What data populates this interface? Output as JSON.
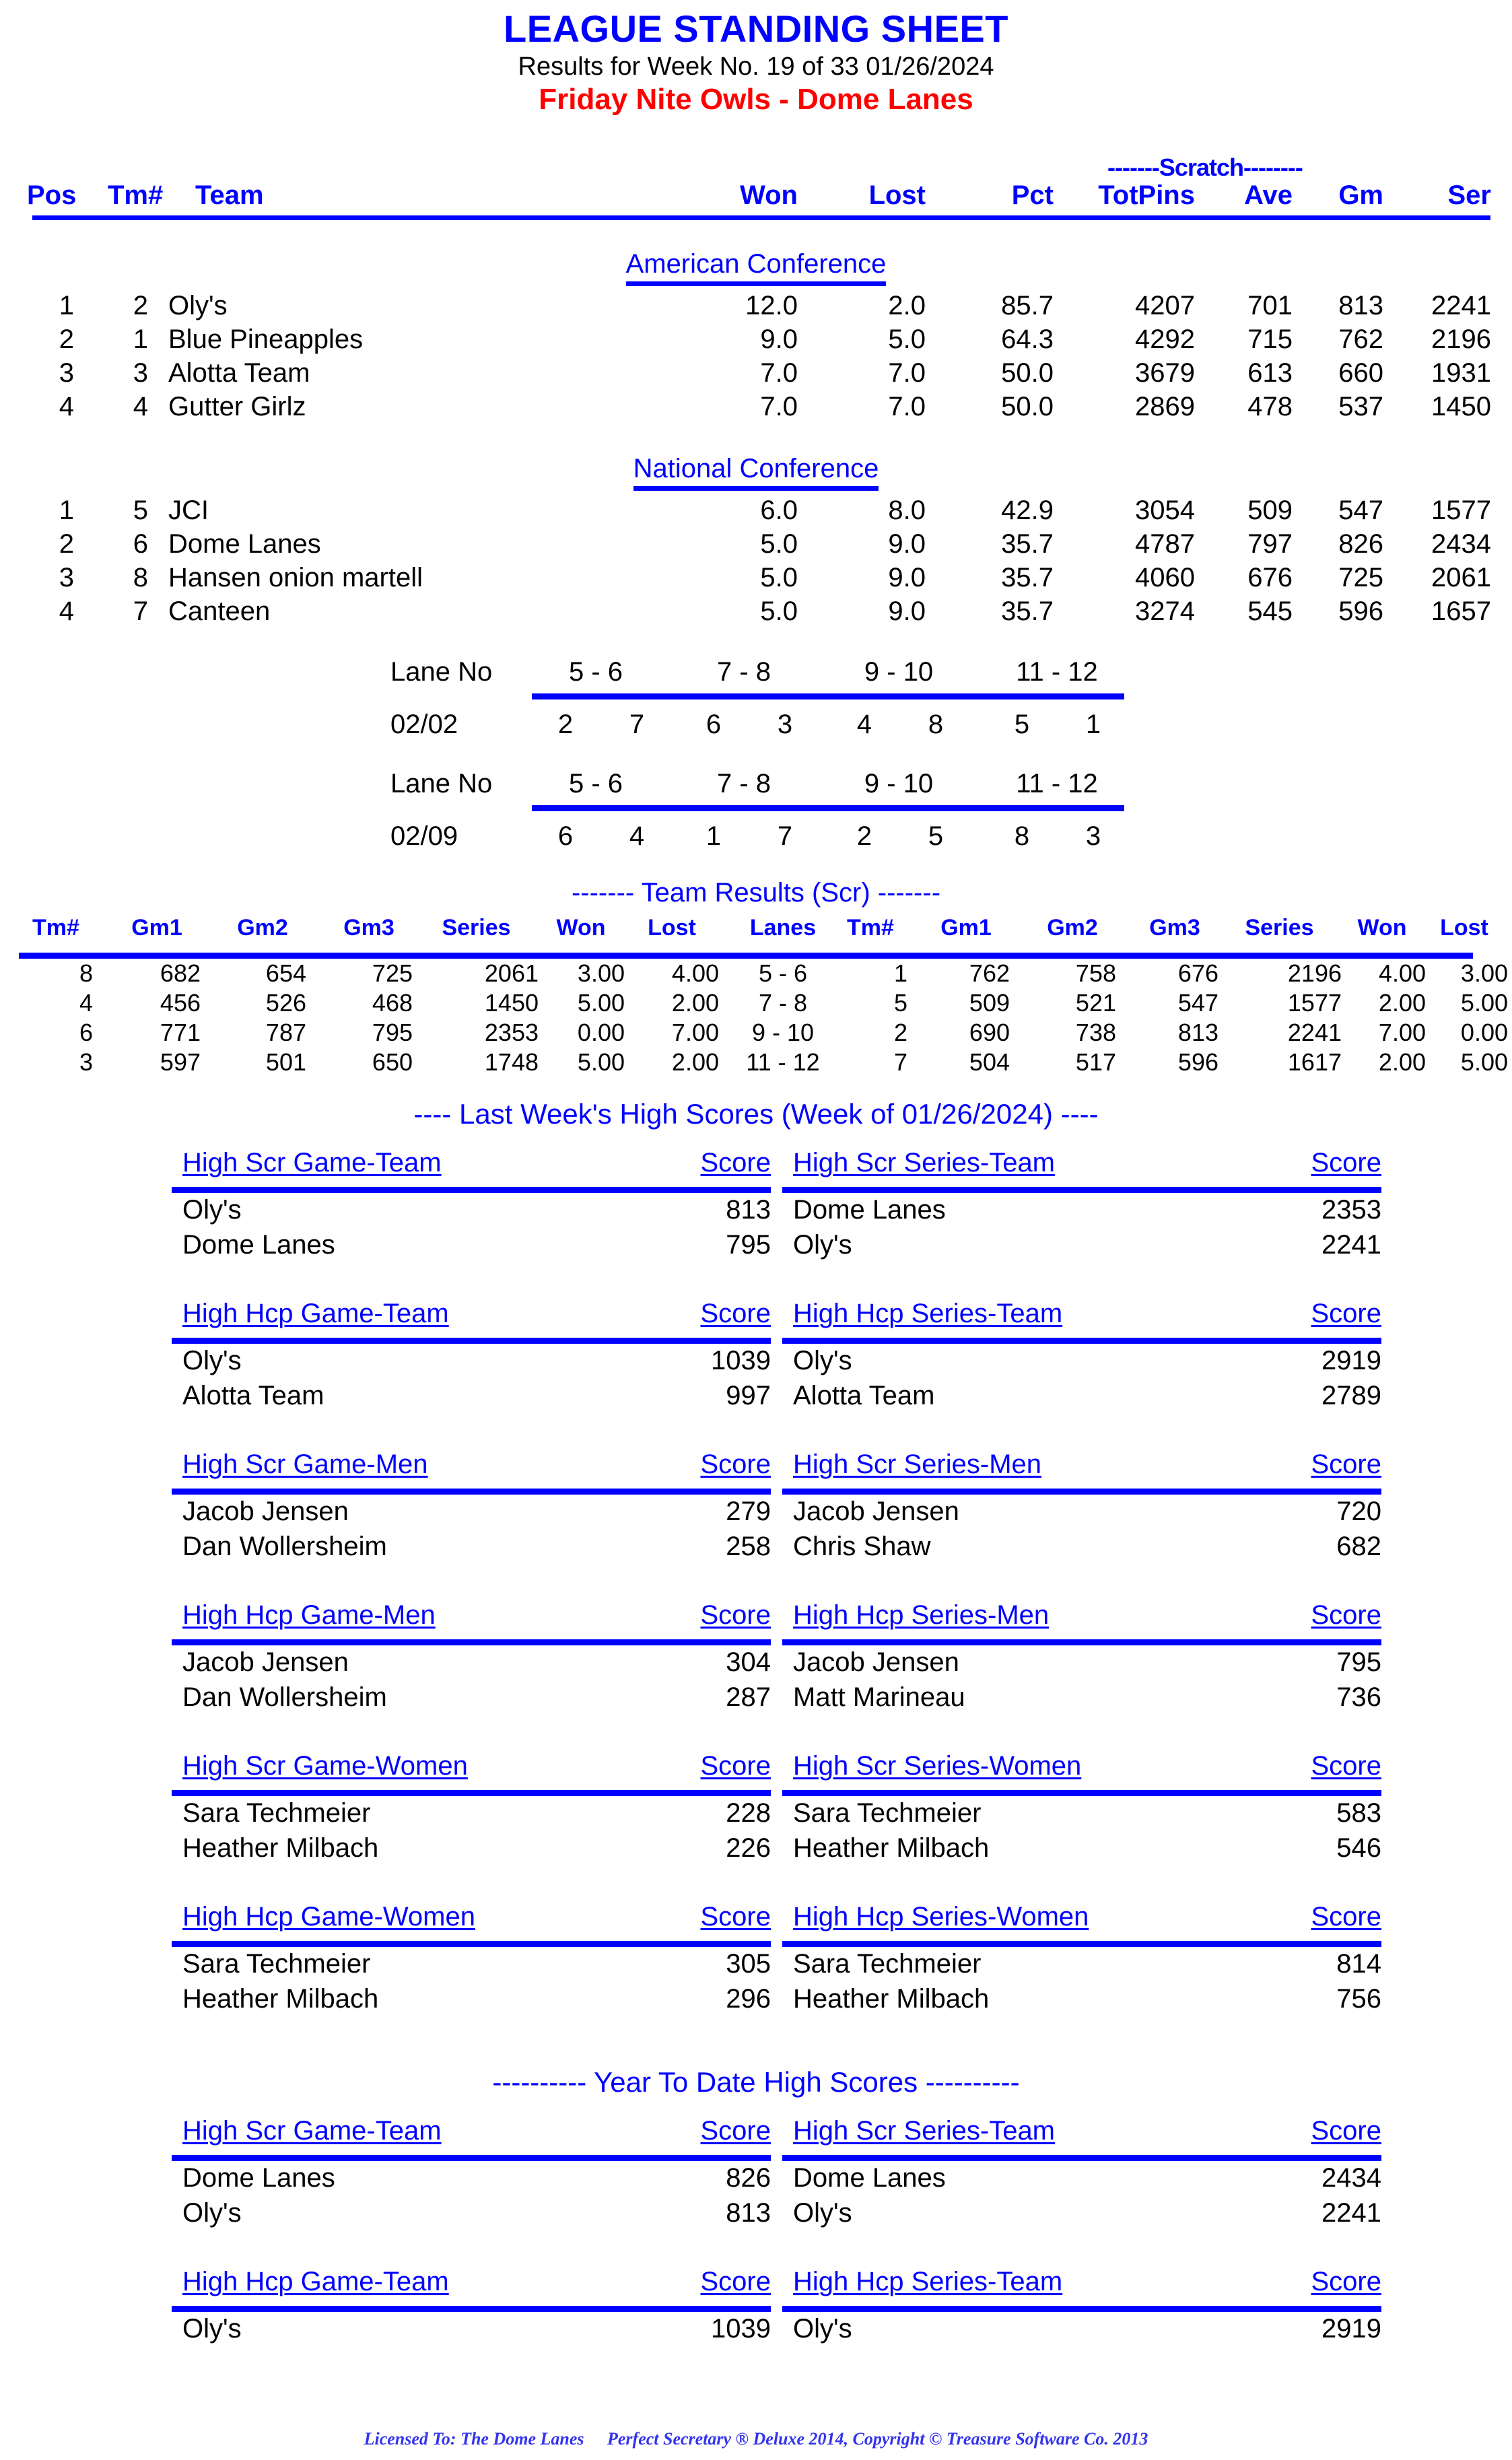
{
  "header": {
    "main_title": "LEAGUE STANDING SHEET",
    "subtitle": "Results for Week No. 19 of 33   01/26/2024",
    "league_title": "Friday Nite Owls - Dome Lanes",
    "scratch_label": "-------Scratch--------"
  },
  "standings": {
    "columns": {
      "pos": "Pos",
      "tm": "Tm#",
      "team": "Team",
      "won": "Won",
      "lost": "Lost",
      "pct": "Pct",
      "totpins": "TotPins",
      "ave": "Ave",
      "gm": "Gm",
      "ser": "Ser"
    },
    "conferences": [
      {
        "name": "American Conference",
        "rows": [
          {
            "pos": "1",
            "tm": "2",
            "team": "Oly's",
            "won": "12.0",
            "lost": "2.0",
            "pct": "85.7",
            "totpins": "4207",
            "ave": "701",
            "gm": "813",
            "ser": "2241"
          },
          {
            "pos": "2",
            "tm": "1",
            "team": "Blue Pineapples",
            "won": "9.0",
            "lost": "5.0",
            "pct": "64.3",
            "totpins": "4292",
            "ave": "715",
            "gm": "762",
            "ser": "2196"
          },
          {
            "pos": "3",
            "tm": "3",
            "team": "Alotta Team",
            "won": "7.0",
            "lost": "7.0",
            "pct": "50.0",
            "totpins": "3679",
            "ave": "613",
            "gm": "660",
            "ser": "1931"
          },
          {
            "pos": "4",
            "tm": "4",
            "team": "Gutter Girlz",
            "won": "7.0",
            "lost": "7.0",
            "pct": "50.0",
            "totpins": "2869",
            "ave": "478",
            "gm": "537",
            "ser": "1450"
          }
        ]
      },
      {
        "name": "National Conference",
        "rows": [
          {
            "pos": "1",
            "tm": "5",
            "team": "JCI",
            "won": "6.0",
            "lost": "8.0",
            "pct": "42.9",
            "totpins": "3054",
            "ave": "509",
            "gm": "547",
            "ser": "1577"
          },
          {
            "pos": "2",
            "tm": "6",
            "team": "Dome Lanes",
            "won": "5.0",
            "lost": "9.0",
            "pct": "35.7",
            "totpins": "4787",
            "ave": "797",
            "gm": "826",
            "ser": "2434"
          },
          {
            "pos": "3",
            "tm": "8",
            "team": "Hansen onion martell",
            "won": "5.0",
            "lost": "9.0",
            "pct": "35.7",
            "totpins": "4060",
            "ave": "676",
            "gm": "725",
            "ser": "2061"
          },
          {
            "pos": "4",
            "tm": "7",
            "team": "Canteen",
            "won": "5.0",
            "lost": "9.0",
            "pct": "35.7",
            "totpins": "3274",
            "ave": "545",
            "gm": "596",
            "ser": "1657"
          }
        ]
      }
    ]
  },
  "lane_schedule": {
    "label": "Lane No",
    "pairs": [
      "5 -  6",
      "7 -  8",
      "9 - 10",
      "11 - 12"
    ],
    "weeks": [
      {
        "date": "02/02",
        "teams": [
          "2",
          "7",
          "6",
          "3",
          "4",
          "8",
          "5",
          "1"
        ]
      },
      {
        "date": "02/09",
        "teams": [
          "6",
          "4",
          "1",
          "7",
          "2",
          "5",
          "8",
          "3"
        ]
      }
    ]
  },
  "team_results": {
    "title": "------- Team Results (Scr) -------",
    "columns": [
      "Tm#",
      "Gm1",
      "Gm2",
      "Gm3",
      "Series",
      "Won",
      "Lost",
      "Lanes",
      "Tm#",
      "Gm1",
      "Gm2",
      "Gm3",
      "Series",
      "Won",
      "Lost"
    ],
    "rows": [
      {
        "l_tm": "8",
        "l_g1": "682",
        "l_g2": "654",
        "l_g3": "725",
        "l_ser": "2061",
        "l_won": "3.00",
        "l_lost": "4.00",
        "lanes": "5 -  6",
        "r_tm": "1",
        "r_g1": "762",
        "r_g2": "758",
        "r_g3": "676",
        "r_ser": "2196",
        "r_won": "4.00",
        "r_lost": "3.00"
      },
      {
        "l_tm": "4",
        "l_g1": "456",
        "l_g2": "526",
        "l_g3": "468",
        "l_ser": "1450",
        "l_won": "5.00",
        "l_lost": "2.00",
        "lanes": "7 -  8",
        "r_tm": "5",
        "r_g1": "509",
        "r_g2": "521",
        "r_g3": "547",
        "r_ser": "1577",
        "r_won": "2.00",
        "r_lost": "5.00"
      },
      {
        "l_tm": "6",
        "l_g1": "771",
        "l_g2": "787",
        "l_g3": "795",
        "l_ser": "2353",
        "l_won": "0.00",
        "l_lost": "7.00",
        "lanes": "9 - 10",
        "r_tm": "2",
        "r_g1": "690",
        "r_g2": "738",
        "r_g3": "813",
        "r_ser": "2241",
        "r_won": "7.00",
        "r_lost": "0.00"
      },
      {
        "l_tm": "3",
        "l_g1": "597",
        "l_g2": "501",
        "l_g3": "650",
        "l_ser": "1748",
        "l_won": "5.00",
        "l_lost": "2.00",
        "lanes": "11 - 12",
        "r_tm": "7",
        "r_g1": "504",
        "r_g2": "517",
        "r_g3": "596",
        "r_ser": "1617",
        "r_won": "2.00",
        "r_lost": "5.00"
      }
    ]
  },
  "last_week": {
    "title": "----  Last Week's High Scores   (Week of 01/26/2024)  ----",
    "score_label": "Score",
    "groups": [
      {
        "left": {
          "category": "High Scr Game-Team",
          "rows": [
            {
              "name": "Oly's",
              "score": "813"
            },
            {
              "name": "Dome Lanes",
              "score": "795"
            }
          ]
        },
        "right": {
          "category": "High Scr Series-Team",
          "rows": [
            {
              "name": "Dome Lanes",
              "score": "2353"
            },
            {
              "name": "Oly's",
              "score": "2241"
            }
          ]
        }
      },
      {
        "left": {
          "category": "High Hcp Game-Team",
          "rows": [
            {
              "name": "Oly's",
              "score": "1039"
            },
            {
              "name": "Alotta Team",
              "score": "997"
            }
          ]
        },
        "right": {
          "category": "High Hcp Series-Team",
          "rows": [
            {
              "name": "Oly's",
              "score": "2919"
            },
            {
              "name": "Alotta Team",
              "score": "2789"
            }
          ]
        }
      },
      {
        "left": {
          "category": "High Scr Game-Men",
          "rows": [
            {
              "name": "Jacob Jensen",
              "score": "279"
            },
            {
              "name": "Dan Wollersheim",
              "score": "258"
            }
          ]
        },
        "right": {
          "category": "High Scr Series-Men",
          "rows": [
            {
              "name": "Jacob Jensen",
              "score": "720"
            },
            {
              "name": "Chris Shaw",
              "score": "682"
            }
          ]
        }
      },
      {
        "left": {
          "category": "High Hcp Game-Men",
          "rows": [
            {
              "name": "Jacob Jensen",
              "score": "304"
            },
            {
              "name": "Dan Wollersheim",
              "score": "287"
            }
          ]
        },
        "right": {
          "category": "High Hcp Series-Men",
          "rows": [
            {
              "name": "Jacob Jensen",
              "score": "795"
            },
            {
              "name": "Matt Marineau",
              "score": "736"
            }
          ]
        }
      },
      {
        "left": {
          "category": "High Scr Game-Women",
          "rows": [
            {
              "name": "Sara Techmeier",
              "score": "228"
            },
            {
              "name": "Heather Milbach",
              "score": "226"
            }
          ]
        },
        "right": {
          "category": "High Scr Series-Women",
          "rows": [
            {
              "name": "Sara Techmeier",
              "score": "583"
            },
            {
              "name": "Heather Milbach",
              "score": "546"
            }
          ]
        }
      },
      {
        "left": {
          "category": "High Hcp Game-Women",
          "rows": [
            {
              "name": "Sara Techmeier",
              "score": "305"
            },
            {
              "name": "Heather Milbach",
              "score": "296"
            }
          ]
        },
        "right": {
          "category": "High Hcp Series-Women",
          "rows": [
            {
              "name": "Sara Techmeier",
              "score": "814"
            },
            {
              "name": "Heather Milbach",
              "score": "756"
            }
          ]
        }
      }
    ]
  },
  "year_to_date": {
    "title": "---------- Year To Date High Scores ----------",
    "score_label": "Score",
    "groups": [
      {
        "left": {
          "category": "High Scr Game-Team",
          "rows": [
            {
              "name": "Dome Lanes",
              "score": "826"
            },
            {
              "name": "Oly's",
              "score": "813"
            }
          ]
        },
        "right": {
          "category": "High Scr Series-Team",
          "rows": [
            {
              "name": "Dome Lanes",
              "score": "2434"
            },
            {
              "name": "Oly's",
              "score": "2241"
            }
          ]
        }
      },
      {
        "left": {
          "category": "High Hcp Game-Team",
          "rows": [
            {
              "name": "Oly's",
              "score": "1039"
            }
          ]
        },
        "right": {
          "category": "High Hcp Series-Team",
          "rows": [
            {
              "name": "Oly's",
              "score": "2919"
            }
          ]
        }
      }
    ]
  },
  "footer": {
    "licensed_to": "Licensed To: The Dome Lanes",
    "copyright": "Perfect Secretary ® Deluxe  2014, Copyright © Treasure Software Co. 2013"
  },
  "colors": {
    "accent_blue": "#0000FF",
    "league_red": "#FF0000",
    "text_black": "#000000",
    "footer_blue": "#3333EE"
  }
}
